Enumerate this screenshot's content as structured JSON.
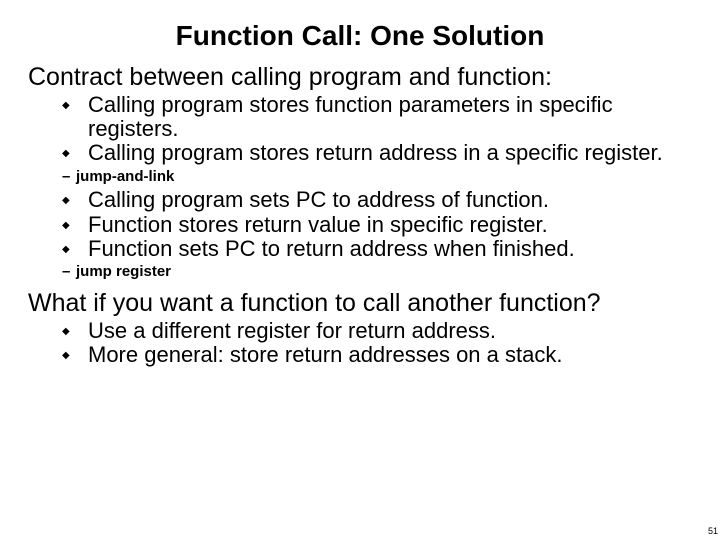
{
  "title": "Function Call:  One Solution",
  "section1": {
    "heading": "Contract between calling program and function:",
    "items_a": [
      "Calling program stores function parameters in specific registers.",
      "Calling program stores return address in a specific register."
    ],
    "sub_a": "jump-and-link",
    "items_b": [
      "Calling program sets PC to address of function.",
      "Function stores return value in specific register.",
      "Function sets PC to return address when finished."
    ],
    "sub_b": "jump register"
  },
  "section2": {
    "heading": "What if you want a function to call another function?",
    "items": [
      "Use a different register for return address.",
      "More general:  store return addresses on a stack."
    ]
  },
  "page_number": "51"
}
